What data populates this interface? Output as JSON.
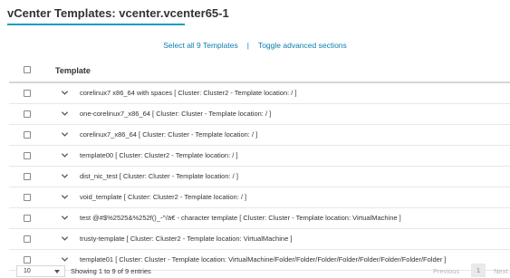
{
  "page": {
    "title": "vCenter Templates: vcenter.vcenter65-1"
  },
  "actions": {
    "select_all": "Select all 9 Templates",
    "separator": "|",
    "toggle_advanced": "Toggle advanced sections"
  },
  "table": {
    "header": "Template",
    "rows": [
      "corelinux7 x86_64 with spaces [ Cluster: Cluster2 - Template location: / ]",
      "one-corelinux7_x86_64 [ Cluster: Cluster - Template location: / ]",
      "corelinux7_x86_64 [ Cluster: Cluster - Template location: / ]",
      "template00 [ Cluster: Cluster2 - Template location: / ]",
      "dist_nic_test [ Cluster: Cluster - Template location: / ]",
      "void_template [ Cluster: Cluster2 - Template location: / ]",
      "test @#$%2525&%252f()_-^/ä€ - character template [ Cluster: Cluster - Template location: VirtualMachine ]",
      "trusty-template [ Cluster: Cluster2 - Template location: VirtualMachine ]",
      "template01 [ Cluster: Cluster - Template location: VirtualMachine/Folder/Folder/Folder/Folder/Folder/Folder/Folder/Folder ]"
    ]
  },
  "footer": {
    "page_size": "10",
    "showing": "Showing 1 to 9 of 9 entries",
    "previous": "Previous",
    "page": "1",
    "next": "Next"
  },
  "colors": {
    "accent": "#1a9bc6",
    "link": "#0a7fb0"
  }
}
